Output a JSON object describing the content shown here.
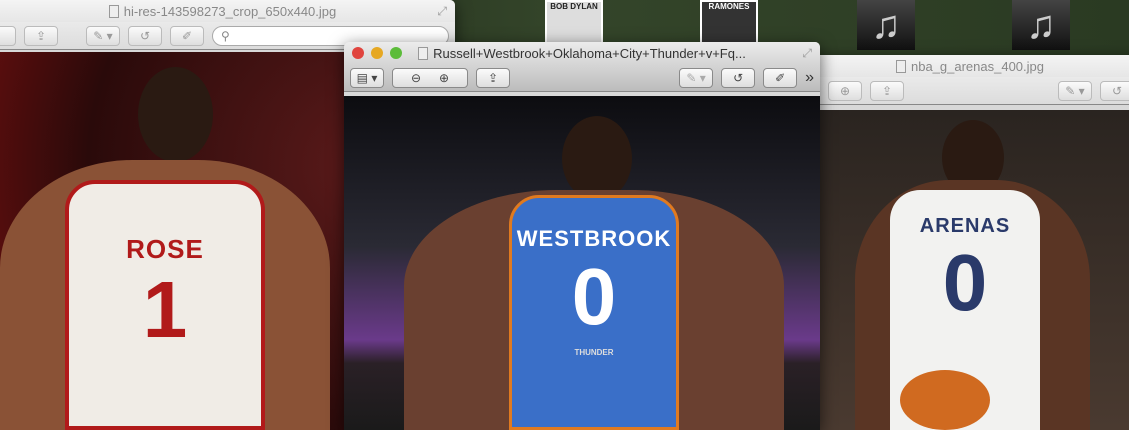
{
  "desktop": {
    "items": [
      {
        "type": "album",
        "label": "BOB DYLAN"
      },
      {
        "type": "album",
        "label": "RAMONES"
      },
      {
        "type": "music",
        "label": "♫"
      },
      {
        "type": "music",
        "label": "♫"
      }
    ]
  },
  "windows": {
    "rose": {
      "title": "hi-res-143598273_crop_650x440.jpg",
      "search_placeholder": "",
      "jersey_name": "ROSE",
      "jersey_number": "1"
    },
    "westbrook": {
      "title": "Russell+Westbrook+Oklahoma+City+Thunder+v+Fq...",
      "jersey_name": "WESTBROOK",
      "jersey_number": "0",
      "shorts_text": "THUNDER"
    },
    "arenas": {
      "title": "nba_g_arenas_400.jpg",
      "jersey_name": "ARENAS",
      "jersey_number": "0"
    }
  },
  "toolbar": {
    "sidebar": "▤ ▾",
    "zoom_out": "⊖",
    "zoom_in": "⊕",
    "share": "⇪",
    "annotate": "✎ ▾",
    "rotate": "↺",
    "edit": "✐",
    "overflow": "»",
    "search_icon": "⚲"
  }
}
